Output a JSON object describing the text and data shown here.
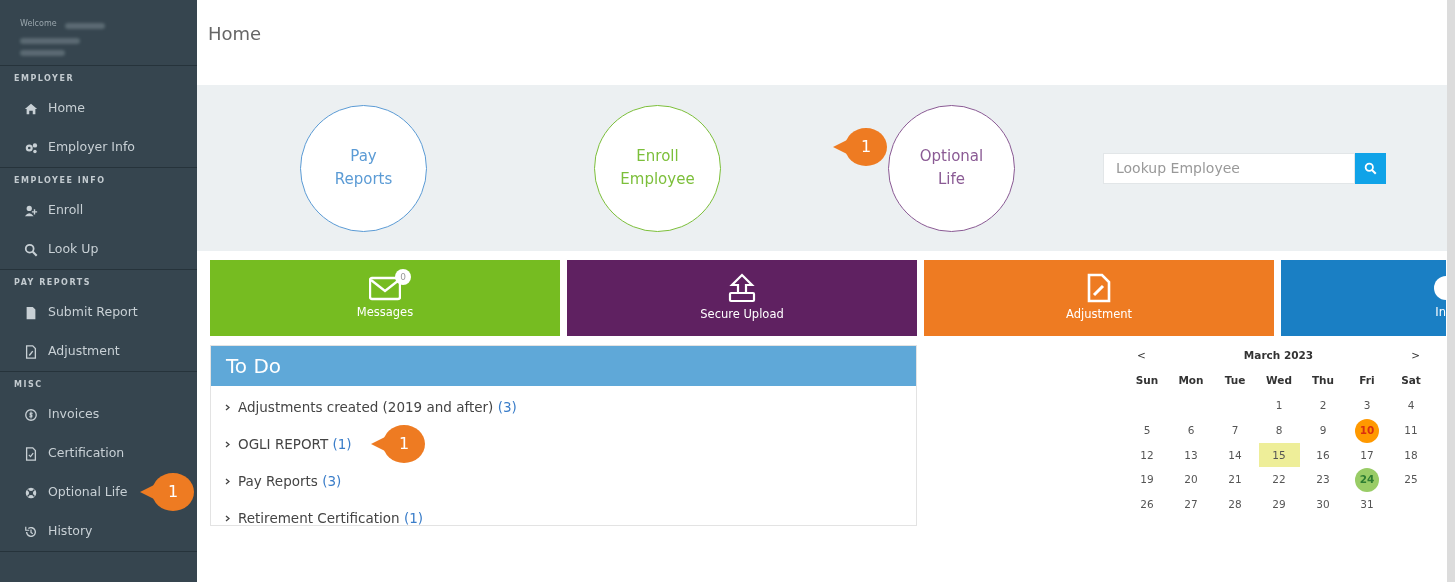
{
  "sidebar": {
    "welcome": "Welcome",
    "sections": [
      {
        "title": "EMPLOYER",
        "items": [
          {
            "label": "Home"
          },
          {
            "label": "Employer Info"
          }
        ]
      },
      {
        "title": "EMPLOYEE INFO",
        "items": [
          {
            "label": "Enroll"
          },
          {
            "label": "Look Up"
          }
        ]
      },
      {
        "title": "PAY REPORTS",
        "items": [
          {
            "label": "Submit Report"
          },
          {
            "label": "Adjustment"
          }
        ]
      },
      {
        "title": "MISC",
        "items": [
          {
            "label": "Invoices"
          },
          {
            "label": "Certification"
          },
          {
            "label": "Optional Life",
            "callout": "1"
          },
          {
            "label": "History"
          }
        ]
      }
    ]
  },
  "page_title": "Home",
  "quick_links": [
    {
      "lines": [
        "Pay",
        "Reports"
      ],
      "color": "#5b9bd5"
    },
    {
      "lines": [
        "Enroll",
        "Employee"
      ],
      "color": "#7cbf3a"
    },
    {
      "lines": [
        "Optional",
        "Life"
      ],
      "color": "#8a5a94",
      "callout": "1"
    }
  ],
  "search": {
    "placeholder": "Lookup Employee"
  },
  "tiles": [
    {
      "label": "Messages",
      "color": "#76bc21",
      "badge": "0"
    },
    {
      "label": "Secure Upload",
      "color": "#5f2161"
    },
    {
      "label": "Adjustment",
      "color": "#ee7b22"
    },
    {
      "label": "In",
      "color": "#1a7fc4"
    }
  ],
  "todo": {
    "title": "To Do",
    "items": [
      {
        "label": "Adjustments created (2019 and after)",
        "count": "(3)"
      },
      {
        "label": "OGLI REPORT",
        "count": "(1)",
        "callout": "1"
      },
      {
        "label": "Pay Reports",
        "count": "(3)"
      },
      {
        "label": "Retirement Certification",
        "count": "(1)"
      }
    ]
  },
  "calendar": {
    "prev": "<",
    "next": ">",
    "month": "March 2023",
    "weekdays": [
      "Sun",
      "Mon",
      "Tue",
      "Wed",
      "Thu",
      "Fri",
      "Sat"
    ],
    "weeks": [
      [
        {
          "day": "1",
          "kind": "plain"
        },
        {
          "day": "2",
          "kind": "plain"
        },
        {
          "day": "3",
          "kind": "plain"
        },
        {
          "day": "4",
          "kind": "plain"
        }
      ],
      [
        {
          "day": "5",
          "kind": "plain"
        },
        {
          "day": "6",
          "kind": "plain"
        },
        {
          "day": "7",
          "kind": "plain"
        },
        {
          "day": "8",
          "kind": "plain"
        },
        {
          "day": "9",
          "kind": "plain"
        },
        {
          "day": "10",
          "kind": "event",
          "color": "#ff9900"
        },
        {
          "day": "11",
          "kind": "plain"
        }
      ],
      [
        {
          "day": "12",
          "kind": "plain"
        },
        {
          "day": "13",
          "kind": "plain"
        },
        {
          "day": "14",
          "kind": "plain"
        },
        {
          "day": "15",
          "kind": "today",
          "color": "#eeee99"
        },
        {
          "day": "16",
          "kind": "plain"
        },
        {
          "day": "17",
          "kind": "plain"
        },
        {
          "day": "18",
          "kind": "plain"
        }
      ],
      [
        {
          "day": "19",
          "kind": "plain"
        },
        {
          "day": "20",
          "kind": "plain"
        },
        {
          "day": "21",
          "kind": "plain"
        },
        {
          "day": "22",
          "kind": "plain"
        },
        {
          "day": "23",
          "kind": "plain"
        },
        {
          "day": "24",
          "kind": "event",
          "color": "#99cc66"
        },
        {
          "day": "25",
          "kind": "plain"
        }
      ],
      [
        {
          "day": "26",
          "kind": "plain"
        },
        {
          "day": "27",
          "kind": "plain"
        },
        {
          "day": "28",
          "kind": "plain"
        },
        {
          "day": "29",
          "kind": "plain"
        },
        {
          "day": "30",
          "kind": "plain"
        },
        {
          "day": "31",
          "kind": "plain"
        }
      ]
    ]
  }
}
